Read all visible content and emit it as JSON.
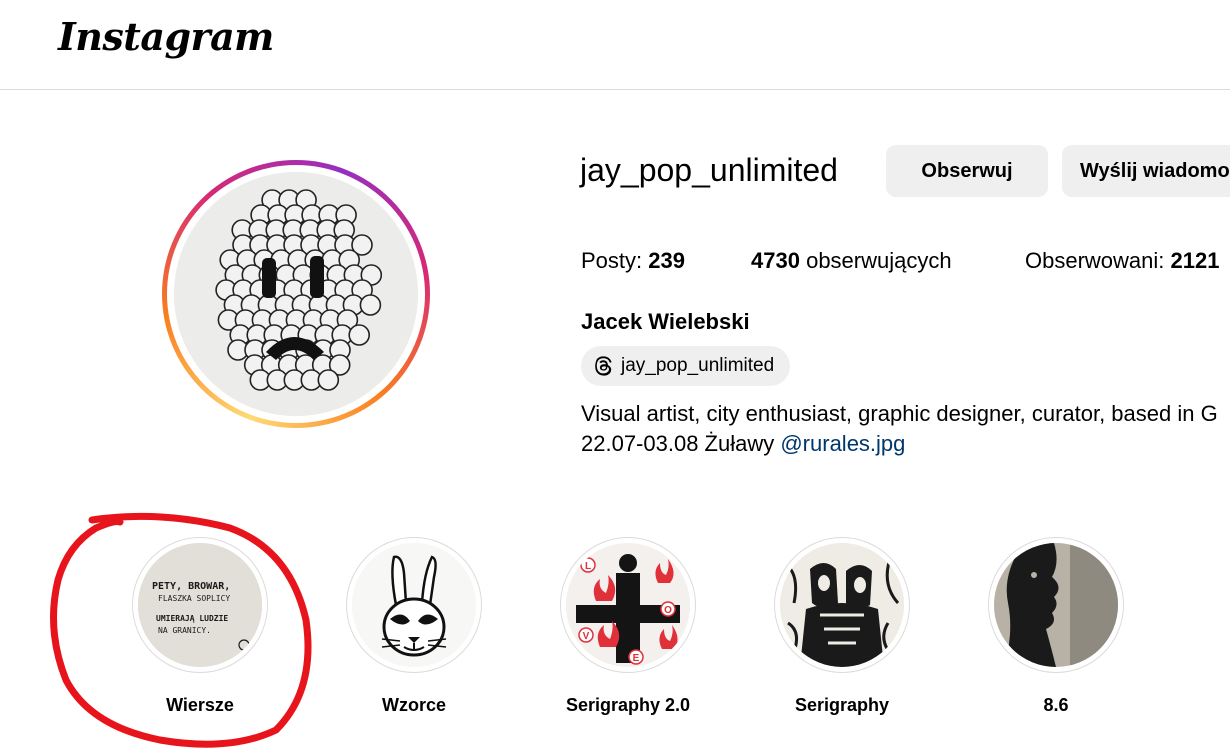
{
  "header": {
    "logo_text": "Instagram"
  },
  "profile": {
    "username": "jay_pop_unlimited",
    "follow_button": "Obserwuj",
    "message_button": "Wyślij wiadomość",
    "stats": {
      "posts_label": "Posty:",
      "posts_value": "239",
      "followers_value": "4730",
      "followers_label": "obserwujących",
      "following_label": "Obserwowani:",
      "following_value": "2121"
    },
    "full_name": "Jacek Wielebski",
    "threads_handle": "jay_pop_unlimited",
    "bio_line1": "Visual artist, city enthusiast, graphic designer, curator, based in G",
    "bio_line2_prefix": "22.07-03.08 Żuławy ",
    "bio_mention": "@rurales.jpg"
  },
  "highlights": [
    {
      "label": "Wiersze",
      "image_text": [
        "PETY, BROWAR,",
        "FLASZKA SOPLICY",
        "UMIERAJĄ LUDZIE",
        "NA GRANICY."
      ]
    },
    {
      "label": "Wzorce"
    },
    {
      "label": "Serigraphy 2.0",
      "image_text": [
        "L",
        "O",
        "V",
        "E"
      ]
    },
    {
      "label": "Serigraphy"
    },
    {
      "label": "8.6"
    }
  ],
  "colors": {
    "annotation": "#e8141b",
    "mention": "#00376b",
    "button_bg": "#efefef"
  }
}
